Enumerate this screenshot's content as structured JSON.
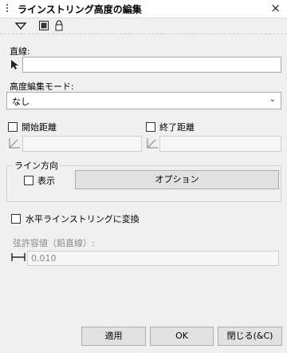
{
  "window": {
    "title": "ラインストリング高度の編集",
    "close_glyph": "×"
  },
  "toolbar": {
    "icons": [
      "triangle-down-icon",
      "display-icon",
      "lock-icon"
    ]
  },
  "straight_line": {
    "label": "直線:",
    "value": ""
  },
  "height_mode": {
    "label": "高度編集モード:",
    "selected": "なし"
  },
  "start_distance": {
    "label": "開始距離",
    "checked": false,
    "value": ""
  },
  "end_distance": {
    "label": "終了距離",
    "checked": false,
    "value": ""
  },
  "line_direction": {
    "group_label": "ライン方向",
    "show_label": "表示",
    "show_checked": false,
    "options_button": "オプション"
  },
  "convert": {
    "label": "水平ラインストリングに変換",
    "checked": false
  },
  "chord_tolerance": {
    "label": "弦許容値（鉛直線）:",
    "value": "0.010"
  },
  "buttons": {
    "apply": "適用",
    "ok": "OK",
    "close": "閉じる(&C)"
  }
}
